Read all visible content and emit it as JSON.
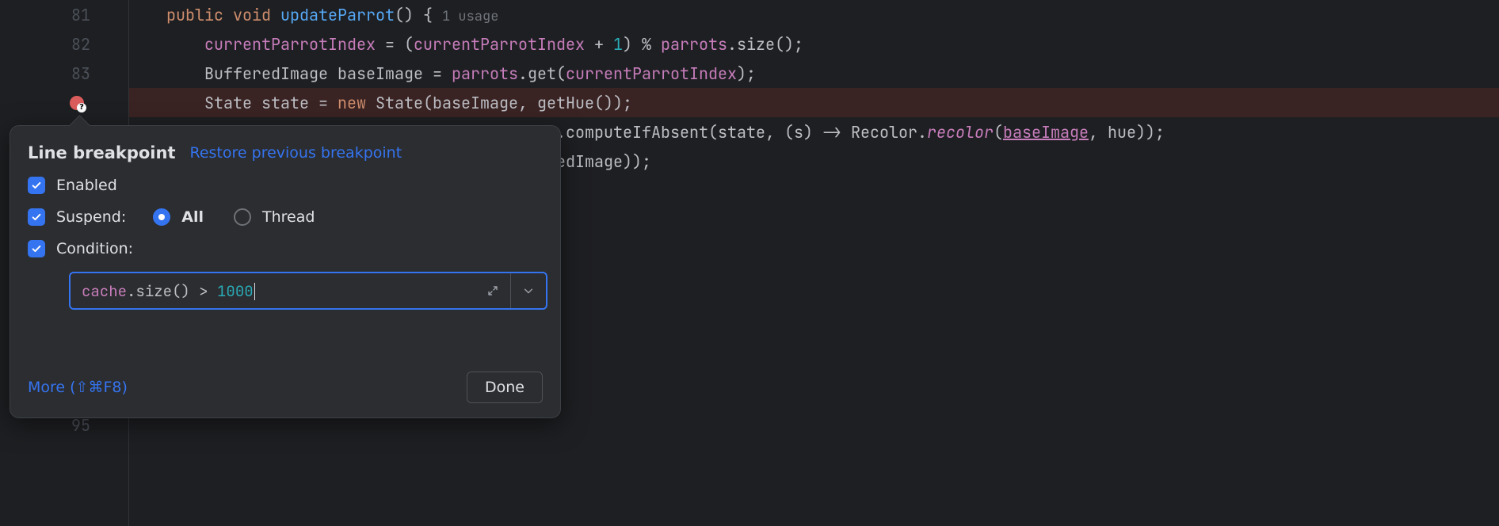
{
  "code": {
    "l81": {
      "num": "81",
      "kw_public": "public",
      "kw_void": "void",
      "fn": "updateParrot",
      "rest": "() {",
      "hint": "1 usage"
    },
    "l82": {
      "num": "82",
      "v1": "currentParrotIndex",
      "eq": " = (",
      "v2": "currentParrotIndex",
      "plus": " + ",
      "one": "1",
      "mod": ") % ",
      "p": "parrots",
      "call": ".size();"
    },
    "l83": {
      "num": "83",
      "type": "BufferedImage ",
      "var": "baseImage",
      "eq": " = ",
      "p": "parrots",
      "get": ".get(",
      "idx": "currentParrotIndex",
      "end": ");"
    },
    "l84": {
      "type": "State ",
      "var": "state",
      "eq": " = ",
      "new": "new",
      "ctor": " State(",
      "a1": "baseImage",
      "c": ", getHue());"
    },
    "l85": {
      "pre": ".computeIfAbsent(",
      "a1": "state",
      "mid": ", (s) -> Recolor.",
      "fn": "recolor",
      "op": "(",
      "bi": "baseImage",
      "rest": ", hue));"
    },
    "l86": {
      "text": "edImage));"
    },
    "l95": {
      "num": "95"
    }
  },
  "popup": {
    "title": "Line breakpoint",
    "restore": "Restore previous breakpoint",
    "enabled": "Enabled",
    "suspend": "Suspend:",
    "all": "All",
    "thread": "Thread",
    "condition": "Condition:",
    "cond_obj": "cache",
    "cond_call": ".size() > ",
    "cond_num": "1000",
    "more": "More (⇧⌘F8)",
    "done": "Done"
  }
}
